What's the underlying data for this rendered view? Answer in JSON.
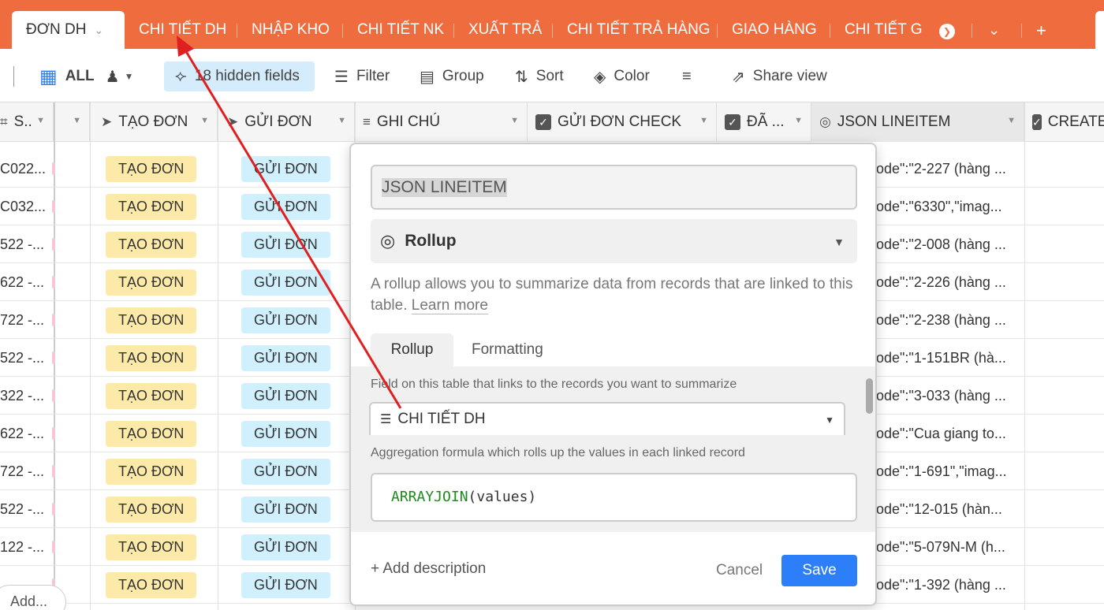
{
  "tabs": {
    "active": "ĐƠN DH",
    "items": [
      "CHI TIẾT DH",
      "NHẬP KHO",
      "CHI TIẾT NK",
      "XUẤT TRẢ",
      "CHI TIẾT TRẢ HÀNG",
      "GIAO HÀNG",
      "CHI TIẾT GI"
    ]
  },
  "toolbar": {
    "view_name": "ALL",
    "hidden_fields": "18 hidden fields",
    "filter": "Filter",
    "group": "Group",
    "sort": "Sort",
    "color": "Color",
    "share_view": "Share view"
  },
  "grid": {
    "headers": [
      "S..",
      "TẠO ĐƠN",
      "GỬI ĐƠN",
      "GHI CHÚ",
      "GỬI ĐƠN CHECK",
      "ĐÃ ...",
      "JSON LINEITEM",
      "CREATE"
    ],
    "pill_tao": "TẠO ĐƠN",
    "pill_gui": "GỬI ĐƠN",
    "rows": [
      {
        "first": "C022...",
        "json": "ode\":\"2-227 (hàng ..."
      },
      {
        "first": "C032...",
        "json": "ode\":\"6330\",\"imag..."
      },
      {
        "first": "522 -...",
        "json": "ode\":\"2-008 (hàng ..."
      },
      {
        "first": "622 -...",
        "json": "ode\":\"2-226 (hàng ..."
      },
      {
        "first": "722 -...",
        "json": "ode\":\"2-238 (hàng ..."
      },
      {
        "first": "522 -...",
        "json": "ode\":\"1-151BR (hà..."
      },
      {
        "first": "322 -...",
        "json": "ode\":\"3-033 (hàng ..."
      },
      {
        "first": "622 -...",
        "json": "ode\":\"Cua giang to..."
      },
      {
        "first": "722 -...",
        "json": "ode\":\"1-691\",\"imag..."
      },
      {
        "first": "522 -...",
        "json": "ode\":\"12-015 (hàn..."
      },
      {
        "first": "122 -...",
        "json": "ode\":\"5-079N-M (h..."
      },
      {
        "first": "",
        "json": "ode\":\"1-392 (hàng ..."
      }
    ],
    "add_label": "Add..."
  },
  "popup": {
    "field_name": "JSON LINEITEM",
    "field_type": "Rollup",
    "description": "A rollup allows you to summarize data from records that are linked to this table.",
    "learn_more": "Learn more",
    "tab_rollup": "Rollup",
    "tab_formatting": "Formatting",
    "link_label": "Field on this table that links to the records you want to summarize",
    "link_value": "CHI TIẾT DH",
    "agg_label": "Aggregation formula which rolls up the values in each linked record",
    "formula_fn": "ARRAYJOIN",
    "formula_args": "(values)",
    "add_description": "+ Add description",
    "cancel": "Cancel",
    "save": "Save"
  },
  "colors": {
    "tabbar": "#ef6c3e",
    "save": "#2d7ff9",
    "pill_tao": "#feeaa8",
    "pill_gui": "#d0f0fd",
    "annotation_arrow": "#e02020"
  }
}
